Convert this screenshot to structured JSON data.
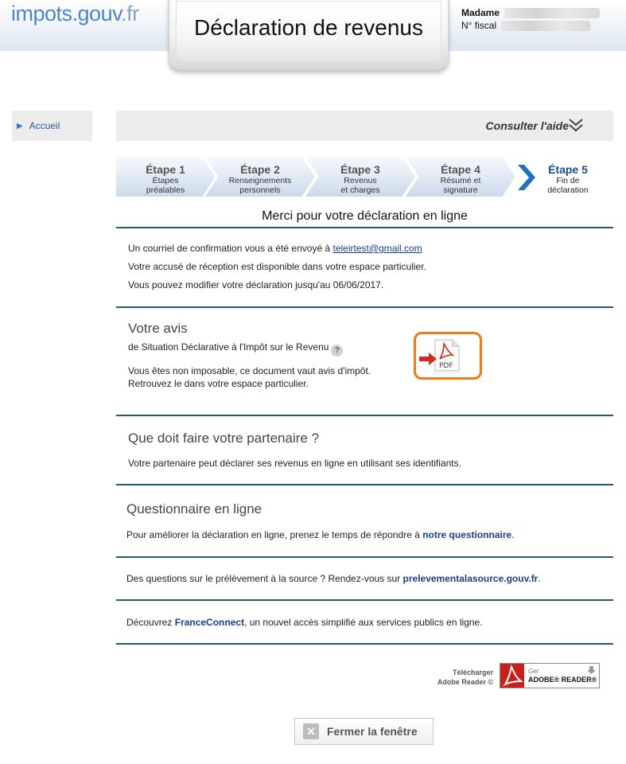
{
  "header": {
    "logo_main": "impots",
    "logo_dot": ".gouv",
    "logo_tld": ".fr",
    "title": "Déclaration de revenus",
    "user_label": "Madame",
    "fiscal_label": "N° fiscal"
  },
  "nav": {
    "home_label": "Accueil"
  },
  "help": {
    "label": "Consulter l'aide"
  },
  "steps": [
    {
      "title": "Étape 1",
      "line1": "Étapes",
      "line2": "préalables"
    },
    {
      "title": "Étape 2",
      "line1": "Renseignements",
      "line2": "personnels"
    },
    {
      "title": "Étape 3",
      "line1": "Revenus",
      "line2": "et charges"
    },
    {
      "title": "Étape 4",
      "line1": "Résumé et",
      "line2": "signature"
    },
    {
      "title": "Étape 5",
      "line1": "Fin de",
      "line2": "déclaration"
    }
  ],
  "confirmation": {
    "heading": "Merci pour votre déclaration en ligne",
    "email_text": "Un courriel de confirmation vous a été envoyé à ",
    "email": "teleirtest@gmail.com",
    "receipt_text": "Votre accusé de réception est disponible dans votre espace particulier.",
    "modify_text": "Vous pouvez modifier votre déclaration jusqu'au 06/06/2017."
  },
  "avis": {
    "title": "Votre avis",
    "subtitle": "de Situation Déclarative à l'Impôt sur le Revenu",
    "help_glyph": "?",
    "line1": "Vous êtes non imposable, ce document vaut avis d'impôt.",
    "line2": "Retrouvez le dans votre espace particulier.",
    "pdf_label": "PDF"
  },
  "partenaire": {
    "title": "Que doit faire votre partenaire ?",
    "text": "Votre partenaire peut déclarer ses revenus en ligne en utilisant ses identifiants."
  },
  "questionnaire": {
    "title": "Questionnaire en ligne",
    "text_before": "Pour améliorer la déclaration en ligne, prenez le temps de répondre à ",
    "link": "notre questionnaire",
    "text_after": "."
  },
  "prelevement": {
    "text_before": "Des questions sur le prélèvement à la source ? Rendez-vous sur ",
    "link": "prelevementalasource.gouv.fr",
    "text_after": "."
  },
  "franceconnect": {
    "text_before": "Découvrez ",
    "link": "FranceConnect",
    "text_after": ", un nouvel accès simplifié aux services publics en ligne."
  },
  "adobe": {
    "label_line1": "Télécharger",
    "label_line2": "Adobe Reader ©",
    "btn_small": "Get",
    "btn_main": "ADOBE® READER®"
  },
  "close": {
    "label": "Fermer la fenêtre",
    "glyph": "✕"
  },
  "colors": {
    "accent": "#1f4c86",
    "divider": "#1f5e70",
    "pdf_frame": "#f07a1a",
    "adobe_red": "#c8201a"
  }
}
